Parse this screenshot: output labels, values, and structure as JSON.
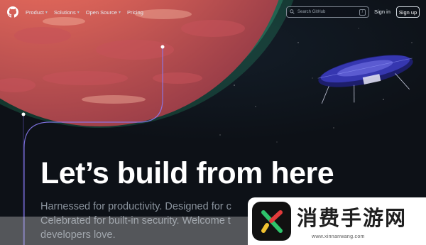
{
  "header": {
    "logo_icon": "github-icon",
    "nav": [
      {
        "label": "Product",
        "has_dropdown": true
      },
      {
        "label": "Solutions",
        "has_dropdown": true
      },
      {
        "label": "Open Source",
        "has_dropdown": true
      },
      {
        "label": "Pricing",
        "has_dropdown": false
      }
    ],
    "search_placeholder": "Search GitHub",
    "search_shortcut": "/",
    "signin_label": "Sign in",
    "signup_label": "Sign up"
  },
  "hero": {
    "headline": "Let’s build from here",
    "subtext": "Harnessed for productivity. Designed for c Celebrated for built-in security. Welcome t developers love."
  },
  "watermark": {
    "title": "消费手游网",
    "url": "www.xinnanwang.com"
  },
  "colors": {
    "background": "#0d1117",
    "planet": "#e0675a",
    "glow": "#3ddc97",
    "line": "#8b7cf6"
  }
}
